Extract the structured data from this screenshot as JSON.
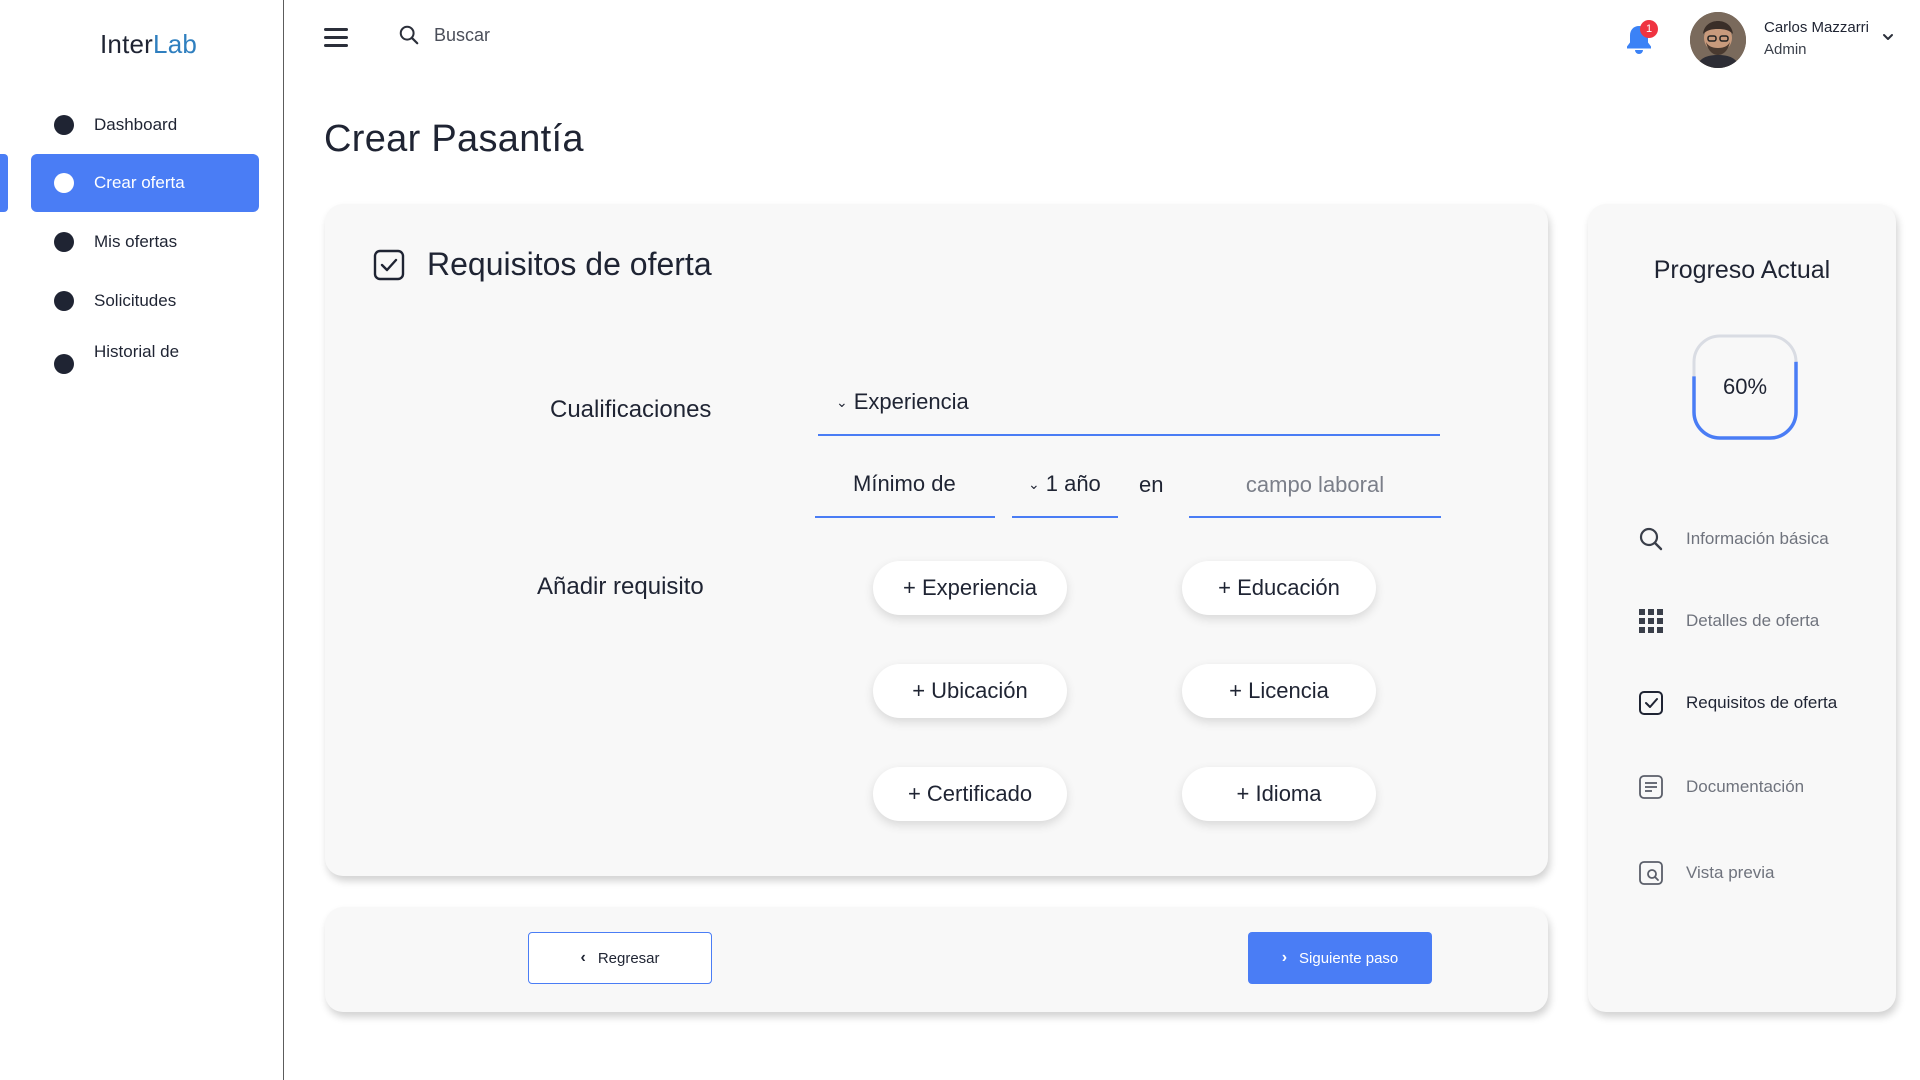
{
  "app": {
    "logo_main": "Inter",
    "logo_accent": "Lab"
  },
  "sidebar": {
    "items": [
      {
        "label": "Dashboard"
      },
      {
        "label": "Crear oferta",
        "active": true
      },
      {
        "label": "Mis ofertas"
      },
      {
        "label": "Solicitudes"
      },
      {
        "label": "Historial de"
      }
    ]
  },
  "topbar": {
    "search_placeholder": "Buscar",
    "notification_count": "1",
    "user_name": "Carlos Mazzarri",
    "user_role": "Admin"
  },
  "page": {
    "title": "Crear Pasantía"
  },
  "requirements": {
    "section_title": "Requisitos de oferta",
    "qualifications_label": "Cualificaciones",
    "qualification_type": "Experiencia",
    "minimum_label": "Mínimo de",
    "duration": "1 año",
    "in_word": "en",
    "field_placeholder": "campo laboral",
    "add_requirement_label": "Añadir requisito",
    "add_buttons": [
      "+ Experiencia",
      "+ Educación",
      "+ Ubicación",
      "+ Licencia",
      "+ Certificado",
      "+ Idioma"
    ]
  },
  "footer": {
    "back_label": "Regresar",
    "next_label": "Siguiente paso"
  },
  "progress": {
    "title": "Progreso Actual",
    "percent": 60,
    "percent_label": "60%",
    "steps": [
      {
        "label": "Información básica",
        "icon": "search-icon"
      },
      {
        "label": "Detalles de oferta",
        "icon": "grid-icon"
      },
      {
        "label": "Requisitos de oferta",
        "icon": "checkbox-icon",
        "current": true
      },
      {
        "label": "Documentación",
        "icon": "document-icon"
      },
      {
        "label": "Vista previa",
        "icon": "preview-icon"
      }
    ]
  },
  "colors": {
    "accent": "#4a7df5",
    "logo_accent": "#2f7fbf",
    "badge": "#ef3340",
    "text": "#1f2433"
  }
}
